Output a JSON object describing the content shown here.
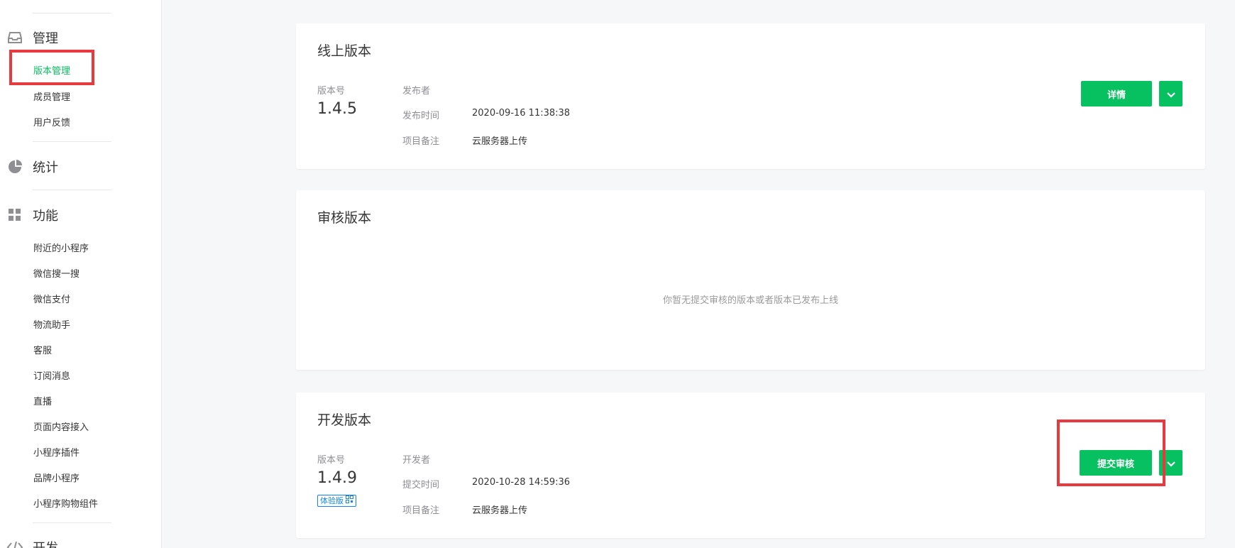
{
  "sidebar": {
    "manage": {
      "label": "管理",
      "icon": "inbox-icon",
      "items": [
        {
          "label": "版本管理",
          "active": true
        },
        {
          "label": "成员管理"
        },
        {
          "label": "用户反馈"
        }
      ]
    },
    "stats": {
      "label": "统计",
      "icon": "pie-chart-icon"
    },
    "features": {
      "label": "功能",
      "icon": "grid-icon",
      "items": [
        {
          "label": "附近的小程序"
        },
        {
          "label": "微信搜一搜"
        },
        {
          "label": "微信支付"
        },
        {
          "label": "物流助手"
        },
        {
          "label": "客服"
        },
        {
          "label": "订阅消息"
        },
        {
          "label": "直播"
        },
        {
          "label": "页面内容接入"
        },
        {
          "label": "小程序插件"
        },
        {
          "label": "品牌小程序"
        },
        {
          "label": "小程序购物组件"
        }
      ]
    },
    "dev": {
      "label": "开发",
      "icon": "code-icon"
    }
  },
  "online": {
    "title": "线上版本",
    "version_label": "版本号",
    "version": "1.4.5",
    "fields": [
      {
        "key": "发布者",
        "value": ""
      },
      {
        "key": "发布时间",
        "value": "2020-09-16 11:38:38"
      },
      {
        "key": "项目备注",
        "value": "云服务器上传"
      }
    ],
    "button": "详情"
  },
  "review": {
    "title": "审核版本",
    "empty": "你暂无提交审核的版本或者版本已发布上线"
  },
  "dev_version": {
    "title": "开发版本",
    "version_label": "版本号",
    "version": "1.4.9",
    "badge": "体验版",
    "fields": [
      {
        "key": "开发者",
        "value": ""
      },
      {
        "key": "提交时间",
        "value": "2020-10-28 14:59:36"
      },
      {
        "key": "项目备注",
        "value": "云服务器上传"
      }
    ],
    "button": "提交审核"
  },
  "colors": {
    "accent": "#07c160",
    "highlight": "#e8393f",
    "badge": "#1485ee"
  }
}
